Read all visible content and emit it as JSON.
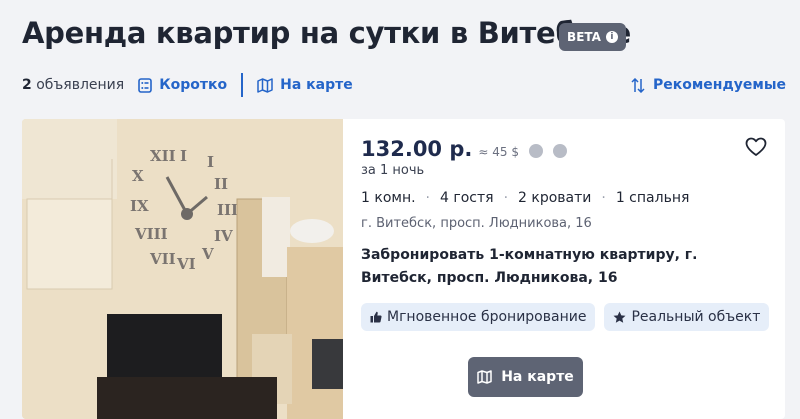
{
  "header": {
    "title": "Аренда квартир на сутки в Витебске",
    "beta_label": "BETA"
  },
  "toolbar": {
    "count_number": "2",
    "count_text": "объявления",
    "short_label": "Коротко",
    "map_label": "На карте",
    "sort_label": "Рекомендуемые"
  },
  "listing": {
    "price": "132.00 р.",
    "usd_price": "≈ 45 $",
    "per_night": "за 1 ночь",
    "features": [
      "1 комн.",
      "4 гостя",
      "2 кровати",
      "1 спальня"
    ],
    "address": "г. Витебск, просп. Людникова, 16",
    "description": "Забронировать 1-комнатную квартиру, г. Витебск, просп. Людникова, 16",
    "badges": [
      "Мгновенное бронирование",
      "Реальный объект"
    ],
    "map_button_label": "На карте"
  },
  "colors": {
    "accent": "#2565c9",
    "button": "#5e6474",
    "badge_bg": "#e6eef9",
    "page_bg": "#f2f3f6"
  },
  "icons": {
    "beta_info": "info-icon",
    "short": "list-icon",
    "map": "map-icon",
    "sort": "sort-arrows-icon",
    "link": "link-icon",
    "price_info": "info-icon",
    "favorite": "heart-icon",
    "instant": "thumbs-up-icon",
    "real": "star-icon"
  }
}
